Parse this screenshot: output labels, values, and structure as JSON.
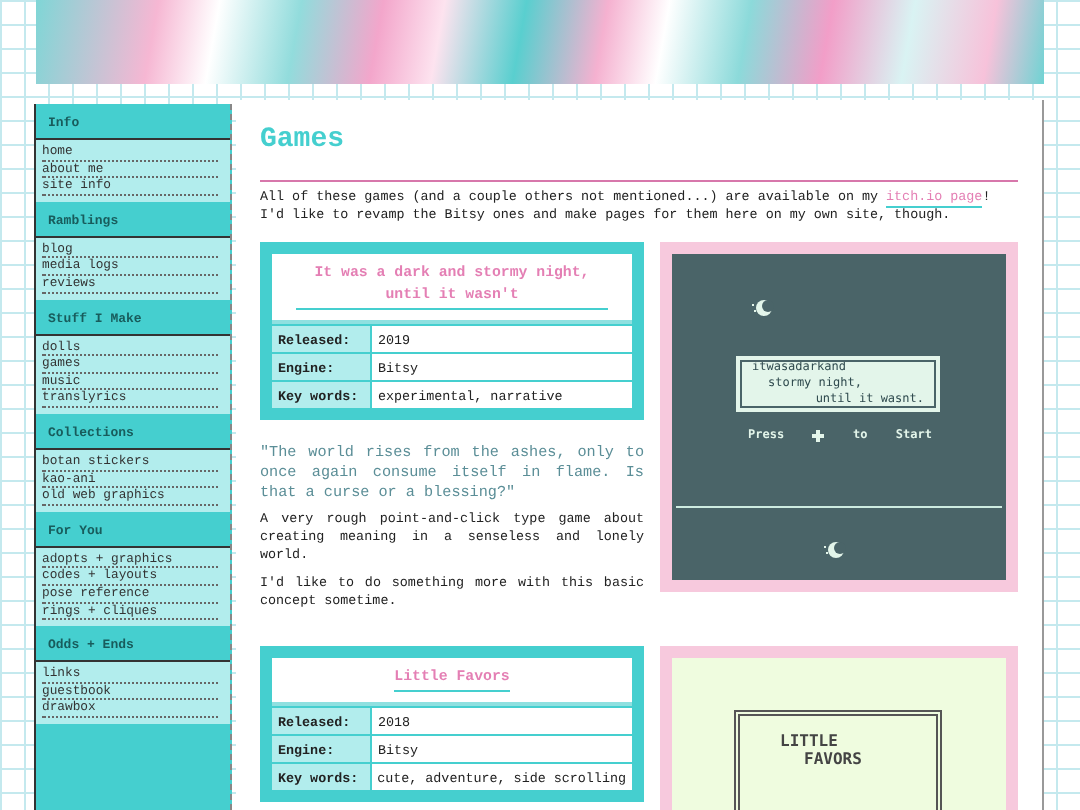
{
  "sidebar": {
    "sections": [
      {
        "title": "Info",
        "links": [
          "home",
          "about me",
          "site info"
        ]
      },
      {
        "title": "Ramblings",
        "links": [
          "blog",
          "media logs",
          "reviews"
        ]
      },
      {
        "title": "Stuff I Make",
        "links": [
          "dolls",
          "games",
          "music",
          "translyrics"
        ]
      },
      {
        "title": "Collections",
        "links": [
          "botan stickers",
          "kao-ani",
          "old web graphics"
        ]
      },
      {
        "title": "For You",
        "links": [
          "adopts + graphics",
          "codes + layouts",
          "pose reference",
          "rings + cliques"
        ]
      },
      {
        "title": "Odds + Ends",
        "links": [
          "links",
          "guestbook",
          "drawbox"
        ]
      }
    ]
  },
  "main": {
    "title": "Games",
    "intro": {
      "before": "All of these games (and a couple others not mentioned...) are available on my ",
      "link": "itch.io page",
      "after": "! I'd like to revamp the Bitsy ones and make pages for them here on my own site, though."
    }
  },
  "games": [
    {
      "title": "It was a dark and stormy night, until it wasn't",
      "details": [
        {
          "label": "Released:",
          "value": "2019"
        },
        {
          "label": "Engine:",
          "value": "Bitsy"
        },
        {
          "label": "Key words:",
          "value": "experimental, narrative"
        }
      ],
      "quote": "\"The world rises from the ashes, only to once again consume itself in flame. Is that a curse or a blessing?\"",
      "paragraphs": [
        "A very rough point-and-click type game about creating meaning in a senseless and lonely world.",
        "I'd like to do something more with this basic concept sometime."
      ],
      "screenshot": {
        "kind": "dark",
        "lines": [
          "itwasadarkand",
          "stormy night,",
          "until it wasnt."
        ],
        "prompt": [
          "Press",
          "to",
          "Start"
        ]
      }
    },
    {
      "title": "Little Favors",
      "details": [
        {
          "label": "Released:",
          "value": "2018"
        },
        {
          "label": "Engine:",
          "value": "Bitsy"
        },
        {
          "label": "Key words:",
          "value": "cute, adventure, side scrolling"
        }
      ],
      "screenshot": {
        "kind": "light",
        "lines": [
          "LITTLE",
          "FAVORS"
        ]
      }
    }
  ]
}
